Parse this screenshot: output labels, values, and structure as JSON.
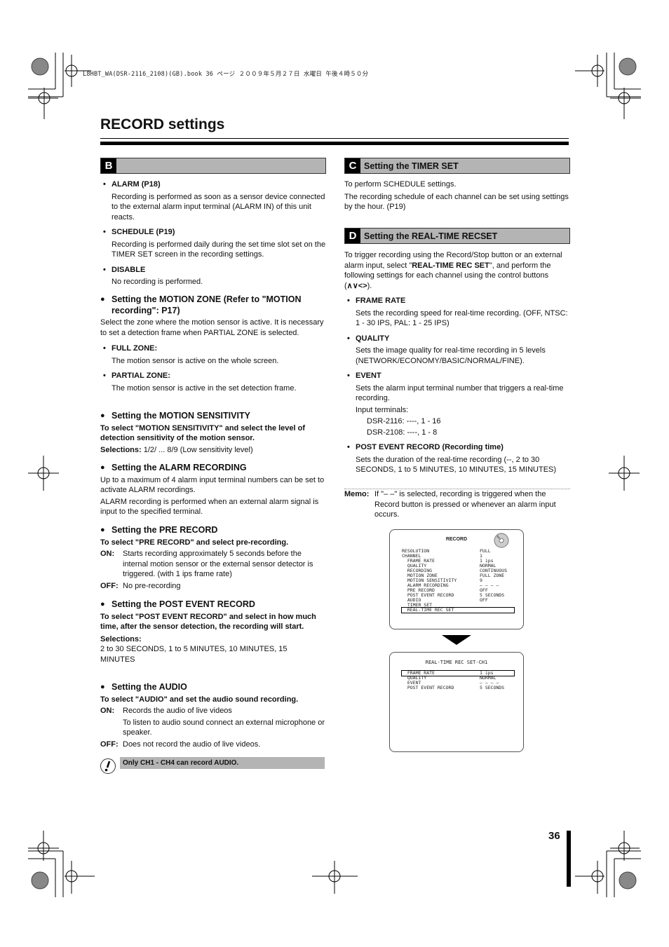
{
  "print_header": "L8HBT_WA(DSR-2116_2108)(GB).book  36 ページ  ２００９年５月２７日  水曜日  午後４時５０分",
  "page_title": "RECORD settings",
  "page_number": "36",
  "section_b": {
    "letter": "B",
    "title": "",
    "items": [
      {
        "head": "ALARM (P18)",
        "body": "Recording is performed as soon as a sensor device connected to the external alarm input terminal (ALARM IN) of this unit reacts."
      },
      {
        "head": "SCHEDULE (P19)",
        "body": "Recording is performed daily during the set time slot set on the TIMER SET screen in the recording settings."
      },
      {
        "head": "DISABLE",
        "body": "No recording is performed."
      }
    ],
    "motion_zone": {
      "heading": "Setting the MOTION ZONE (Refer to \"MOTION recording\": P17)",
      "body": "Select the zone where the motion sensor is active. It is necessary to set a detection frame when PARTIAL ZONE is selected.",
      "items": [
        {
          "head": "FULL ZONE:",
          "body": "The motion sensor is active on the whole screen."
        },
        {
          "head": "PARTIAL ZONE:",
          "body": "The motion sensor is active in the set detection frame."
        }
      ]
    },
    "motion_sensitivity": {
      "heading": "Setting the MOTION SENSITIVITY",
      "instruction": "To select \"MOTION SENSITIVITY\" and select the level of detection sensitivity of the motion sensor.",
      "selections_label": "Selections:",
      "selections_value": "1/2/ ... 8/9 (Low sensitivity level)"
    },
    "alarm_recording": {
      "heading": "Setting the ALARM RECORDING",
      "body1": "Up to a maximum of 4 alarm input terminal numbers can be set to activate ALARM recordings.",
      "body2": "ALARM recording is performed when an external alarm signal is input to the specified terminal."
    },
    "pre_record": {
      "heading": "Setting the PRE RECORD",
      "instruction": "To select \"PRE RECORD\" and select pre-recording.",
      "on_label": "ON:",
      "on_text": "Starts recording approximately 5 seconds before the internal motion sensor or the external sensor detector is triggered. (with 1 ips frame rate)",
      "off_label": "OFF:",
      "off_text": "No pre-recording"
    },
    "post_event": {
      "heading": "Setting the POST EVENT RECORD",
      "instruction": "To select \"POST EVENT RECORD\" and select in how much time, after the sensor detection, the recording will start.",
      "selections_label": "Selections:",
      "selections_value": "2 to 30 SECONDS, 1 to 5 MINUTES, 10 MINUTES, 15 MINUTES"
    },
    "audio": {
      "heading": "Setting the AUDIO",
      "instruction": "To select \"AUDIO\" and set the audio sound recording.",
      "on_label": "ON:",
      "on_text1": "Records the audio of live videos",
      "on_text2": "To listen to audio sound connect an external microphone or speaker.",
      "off_label": "OFF:",
      "off_text": "Does not record the audio of live videos."
    },
    "note": "Only CH1 - CH4 can record AUDIO."
  },
  "section_c": {
    "letter": "C",
    "title": "Setting the TIMER SET",
    "body1": "To perform SCHEDULE settings.",
    "body2": "The recording schedule of each channel can be set using settings by the hour. (P19)"
  },
  "section_d": {
    "letter": "D",
    "title": "Setting the REAL-TIME RECSET",
    "intro_a": "To trigger recording using the Record/Stop button or an external alarm input, select \"",
    "intro_bold": "REAL-TIME REC SET",
    "intro_b": "\", and perform the following settings for each channel using the control buttons (",
    "intro_buttons": "∧∨<>",
    "intro_c": ").",
    "items": [
      {
        "head": "FRAME RATE",
        "body": "Sets the recording speed for real-time recording. (OFF, NTSC: 1 - 30 IPS, PAL: 1 - 25 IPS)"
      },
      {
        "head": "QUALITY",
        "body": "Sets the image quality for real-time recording in 5 levels (NETWORK/ECONOMY/BASIC/NORMAL/FINE)."
      },
      {
        "head": "EVENT",
        "body": "Sets the alarm input terminal number that triggers a real-time recording.",
        "sub_label": "Input terminals:",
        "sub_lines": [
          "DSR-2116: ----, 1 - 16",
          "DSR-2108: ----, 1 - 8"
        ]
      },
      {
        "head": "POST EVENT RECORD (Recording time)",
        "body": "Sets the duration of the real-time recording (--, 2 to 30 SECONDS, 1 to 5 MINUTES, 10 MINUTES, 15 MINUTES)"
      }
    ],
    "memo_label": "Memo:",
    "memo_text": "If \"– –\" is selected, recording is triggered when the Record button is pressed or whenever an alarm input occurs."
  },
  "osd_record": {
    "title": "RECORD",
    "rows": [
      {
        "label": "RESOLUTION",
        "value": "FULL"
      },
      {
        "label": "CHANNEL",
        "value": "1"
      },
      {
        "label": "  FRAME RATE",
        "value": "1 ips"
      },
      {
        "label": "  QUALITY",
        "value": "NORMAL"
      },
      {
        "label": "  RECORDING",
        "value": "CONTINUOUS"
      },
      {
        "label": "  MOTION ZONE",
        "value": "FULL ZONE"
      },
      {
        "label": "  MOTION SENSITIVITY",
        "value": "9"
      },
      {
        "label": "  ALARM RECORDING",
        "value": "– – – –"
      },
      {
        "label": "  PRE RECORD",
        "value": "OFF"
      },
      {
        "label": "  POST EVENT RECORD",
        "value": "5 SECONDS"
      },
      {
        "label": "  AUDIO",
        "value": "OFF"
      },
      {
        "label": "  TIMER SET",
        "value": ""
      },
      {
        "label": "  REAL-TIME REC SET",
        "value": ""
      }
    ]
  },
  "osd_realtime": {
    "title": "REAL-TIME REC SET-CH1",
    "rows": [
      {
        "label": "  FRAME RATE",
        "value": "1 ips"
      },
      {
        "label": "  QUALITY",
        "value": "NORMAL"
      },
      {
        "label": "  EVENT",
        "value": "– – – –"
      },
      {
        "label": "  POST EVENT RECORD",
        "value": "5 SECONDS"
      }
    ]
  }
}
